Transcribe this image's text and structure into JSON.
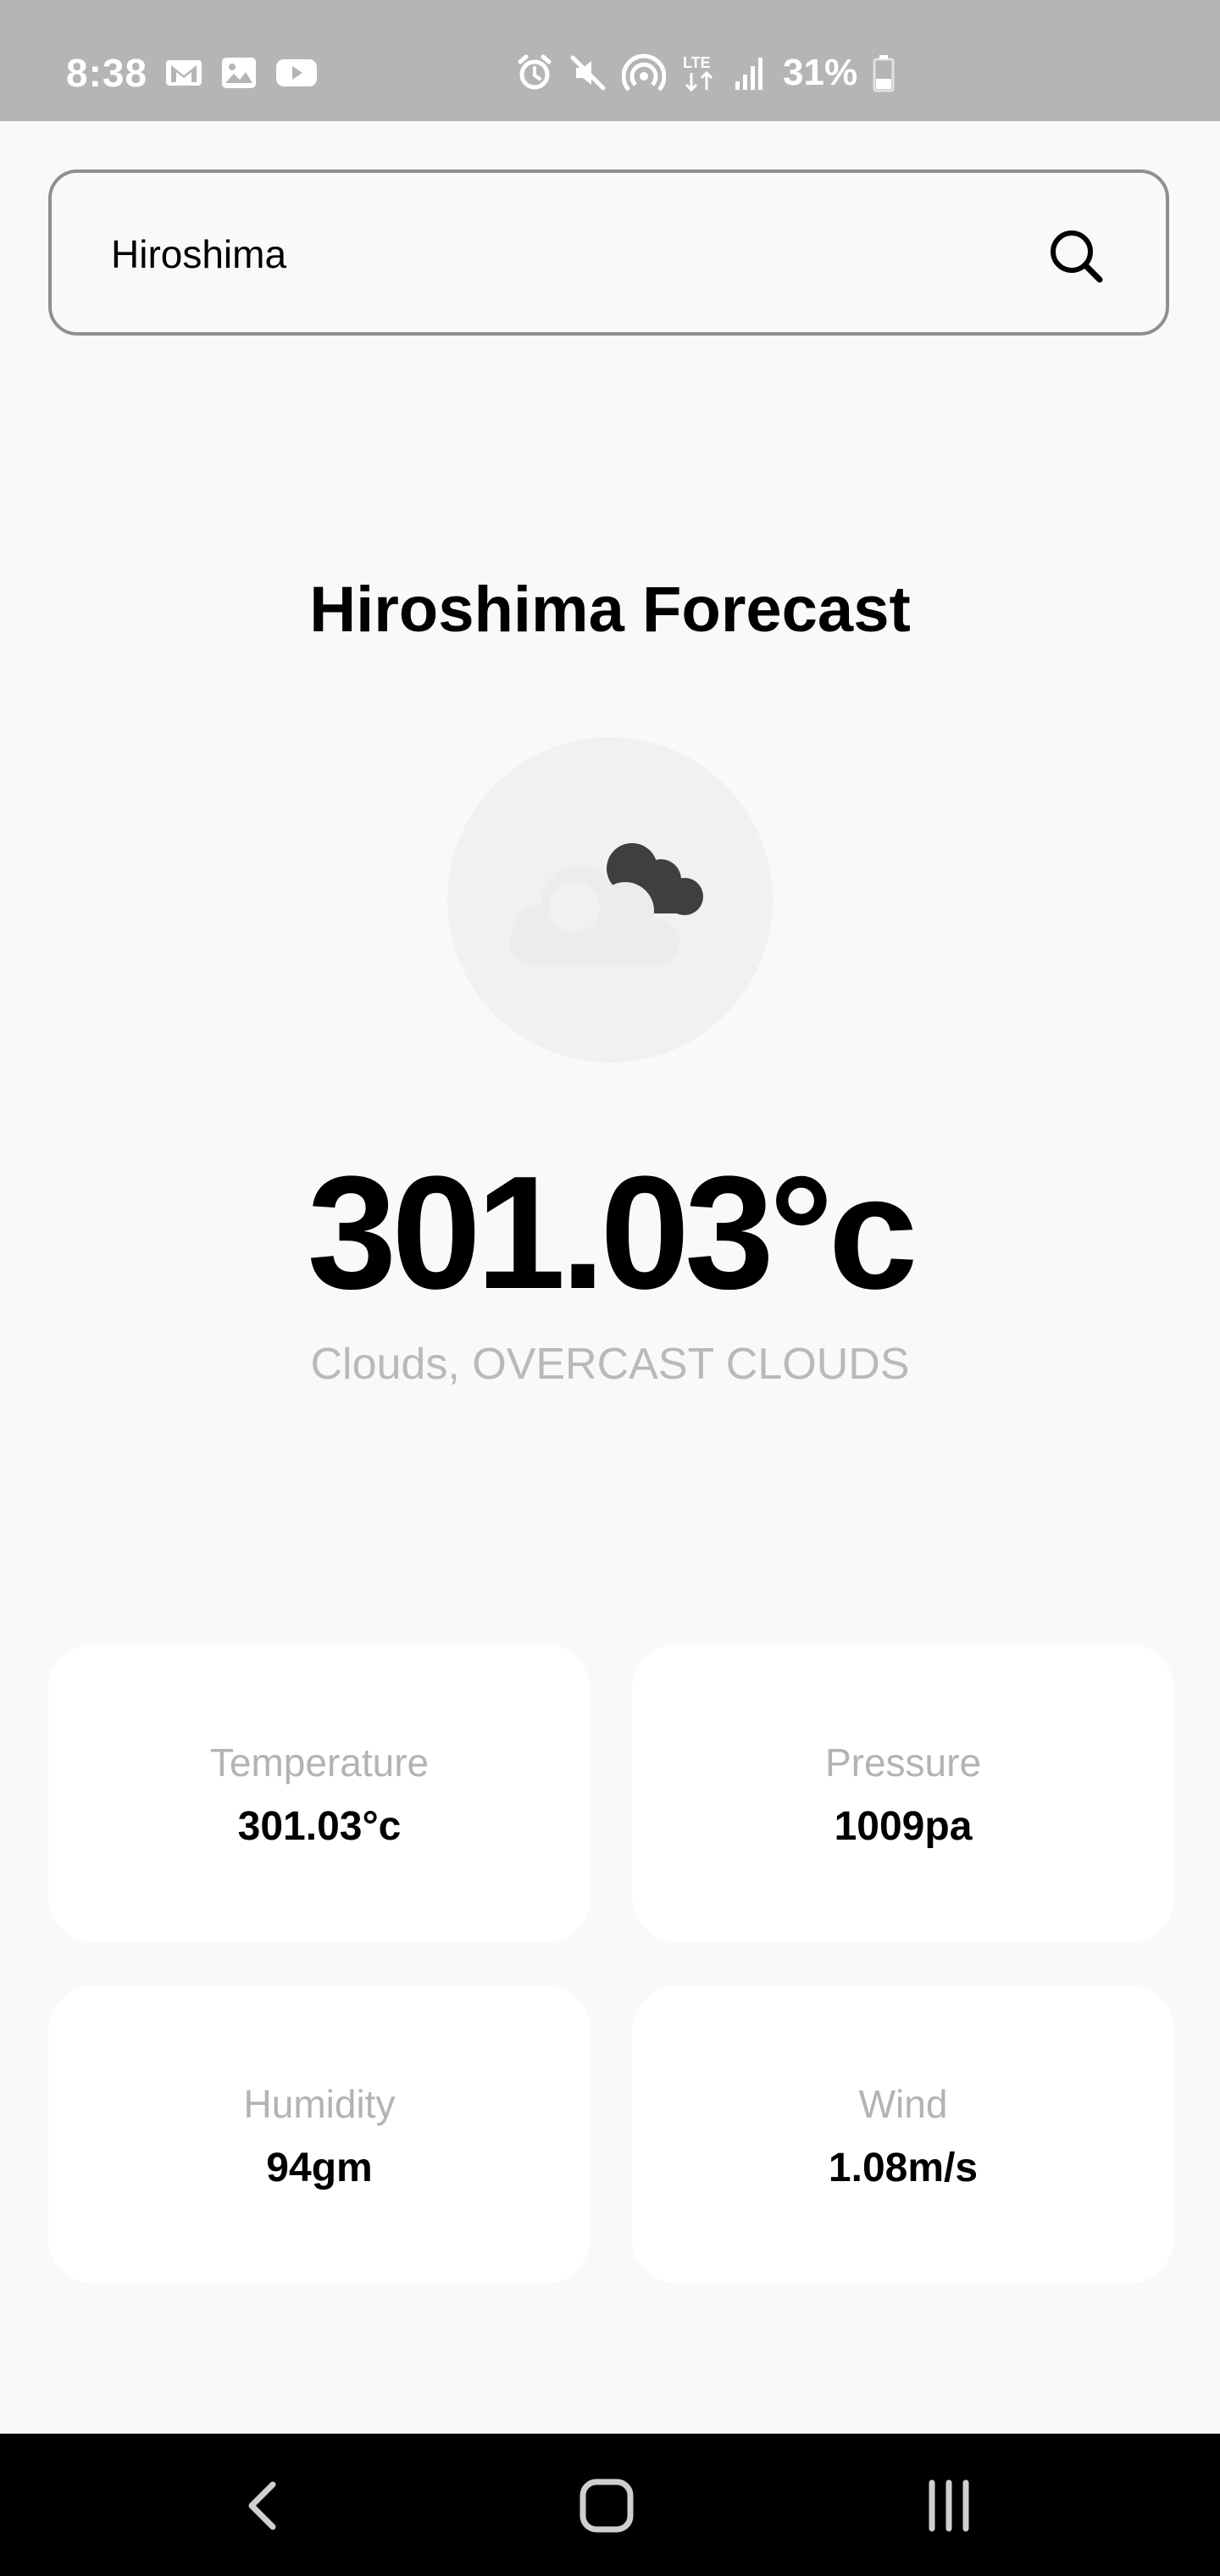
{
  "status_bar": {
    "time": "8:38",
    "battery": "31%",
    "icons_left": [
      "gmail-icon",
      "gallery-icon",
      "youtube-icon"
    ],
    "icons_right": [
      "alarm-icon",
      "mute-icon",
      "hotspot-icon",
      "lte-icon",
      "signal-icon",
      "battery-icon"
    ],
    "lte_label": "LTE"
  },
  "search": {
    "value": "Hiroshima",
    "icon": "search-icon"
  },
  "forecast": {
    "title": "Hiroshima Forecast",
    "weather_icon": "overcast-clouds-icon",
    "temperature": "301.03°c",
    "description": "Clouds, OVERCAST CLOUDS"
  },
  "cards": {
    "temperature": {
      "label": "Temperature",
      "value": "301.03°c"
    },
    "pressure": {
      "label": "Pressure",
      "value": "1009pa"
    },
    "humidity": {
      "label": "Humidity",
      "value": "94gm"
    },
    "wind": {
      "label": "Wind",
      "value": "1.08m/s"
    }
  },
  "nav_bar": {
    "icons": [
      "back-icon",
      "home-icon",
      "recent-apps-icon"
    ]
  },
  "colors": {
    "status_bar_bg": "#b5b5b5",
    "page_bg": "#f9f9f9",
    "card_bg": "#ffffff",
    "muted_text": "#b3b3b3",
    "nav_bar_bg": "#000000"
  }
}
